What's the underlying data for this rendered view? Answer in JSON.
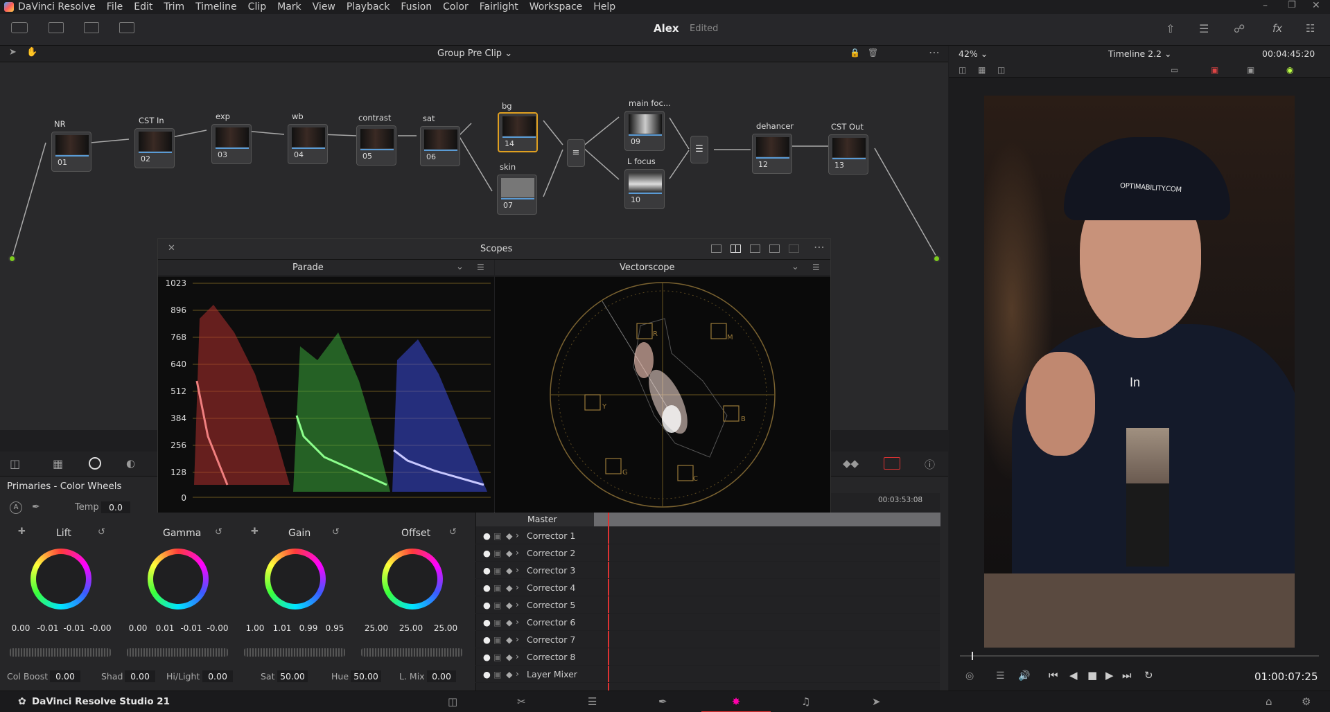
{
  "menu": {
    "app": "DaVinci Resolve",
    "items": [
      "File",
      "Edit",
      "Trim",
      "Timeline",
      "Clip",
      "Mark",
      "View",
      "Playback",
      "Fusion",
      "Color",
      "Fairlight",
      "Workspace",
      "Help"
    ]
  },
  "project": {
    "name": "Alex",
    "status": "Edited"
  },
  "node_editor": {
    "mode": "Group Pre Clip",
    "nodes": [
      {
        "label": "NR",
        "num": "01"
      },
      {
        "label": "CST In",
        "num": "02"
      },
      {
        "label": "exp",
        "num": "03"
      },
      {
        "label": "wb",
        "num": "04"
      },
      {
        "label": "contrast",
        "num": "05"
      },
      {
        "label": "sat",
        "num": "06"
      },
      {
        "label": "bg",
        "num": "14"
      },
      {
        "label": "skin",
        "num": "07"
      },
      {
        "label": "main foc...",
        "num": "09"
      },
      {
        "label": "L focus",
        "num": "10"
      },
      {
        "label": "dehancer",
        "num": "12"
      },
      {
        "label": "CST Out",
        "num": "13"
      }
    ]
  },
  "scopes": {
    "title": "Scopes",
    "left": {
      "name": "Parade",
      "ticks": [
        "1023",
        "896",
        "768",
        "640",
        "512",
        "384",
        "256",
        "128",
        "0"
      ]
    },
    "right": {
      "name": "Vectorscope",
      "targets": [
        "R",
        "M",
        "B",
        "C",
        "G",
        "Y"
      ]
    }
  },
  "viewer": {
    "zoom": "42%",
    "timeline": "Timeline 2.2",
    "duration": "00:04:45:20",
    "timecode": "01:00:07:25",
    "caption": "In",
    "cap_text": "OPTIMABILITY.COM"
  },
  "primaries": {
    "title": "Primaries - Color Wheels",
    "temp_label": "Temp",
    "temp": "0.0",
    "wheels": [
      {
        "name": "Lift",
        "vals": [
          "0.00",
          "-0.01",
          "-0.01",
          "-0.00"
        ]
      },
      {
        "name": "Gamma",
        "vals": [
          "0.00",
          "0.01",
          "-0.01",
          "-0.00"
        ]
      },
      {
        "name": "Gain",
        "vals": [
          "1.00",
          "1.01",
          "0.99",
          "0.95"
        ]
      },
      {
        "name": "Offset",
        "vals": [
          "25.00",
          "25.00",
          "25.00"
        ]
      }
    ],
    "bottom": [
      {
        "label": "Col Boost",
        "value": "0.00"
      },
      {
        "label": "Shad",
        "value": "0.00"
      },
      {
        "label": "Hi/Light",
        "value": "0.00"
      },
      {
        "label": "Sat",
        "value": "50.00"
      },
      {
        "label": "Hue",
        "value": "50.00"
      },
      {
        "label": "L. Mix",
        "value": "0.00"
      }
    ]
  },
  "layers": {
    "header": "Master",
    "timecode": "00:03:53:08",
    "rows": [
      "Corrector 1",
      "Corrector 2",
      "Corrector 3",
      "Corrector 4",
      "Corrector 5",
      "Corrector 6",
      "Corrector 7",
      "Corrector 8",
      "Layer Mixer"
    ]
  },
  "status": {
    "product": "DaVinci Resolve Studio 21"
  }
}
